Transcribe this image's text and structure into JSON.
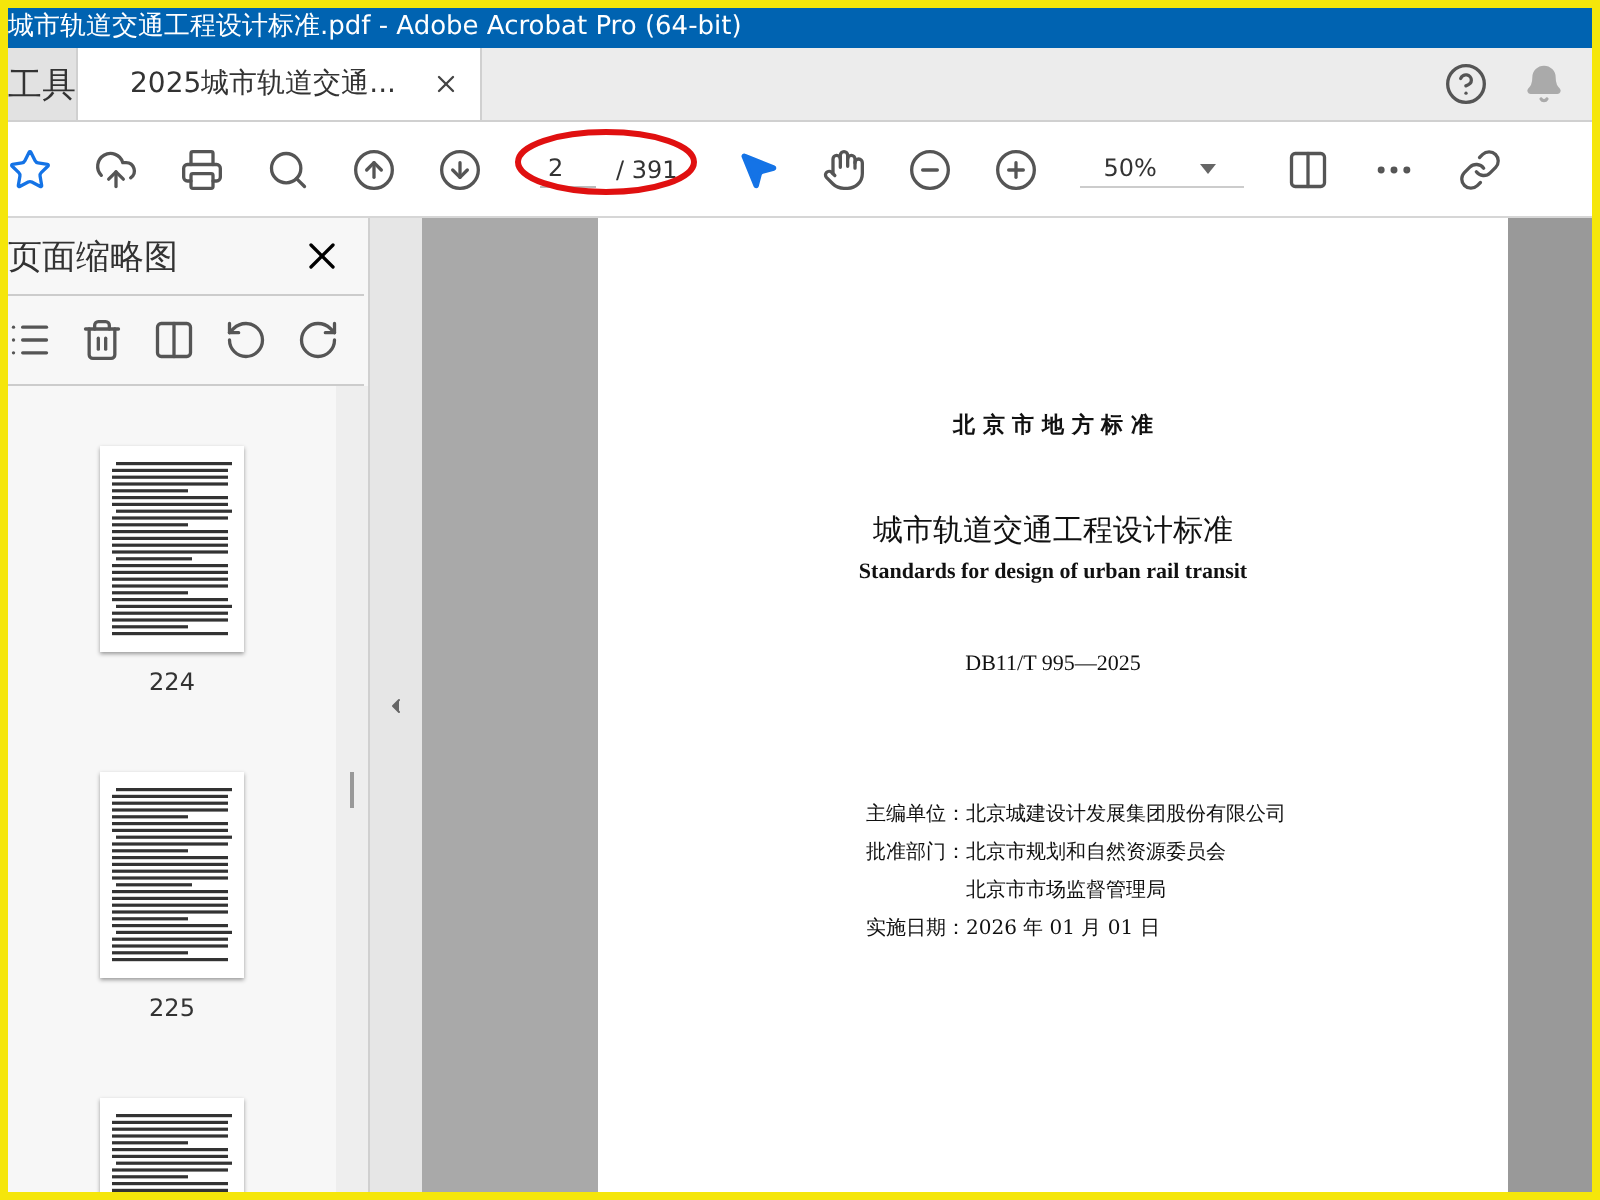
{
  "window": {
    "title": "城市轨道交通工程设计标准.pdf - Adobe Acrobat Pro (64-bit)"
  },
  "tabs": [
    {
      "label": "工具",
      "selected": false,
      "closable": false
    },
    {
      "label": "2025城市轨道交通...",
      "selected": true,
      "closable": true
    }
  ],
  "toolbar": {
    "page_value": "2",
    "page_total": "/ 391",
    "zoom": "50%"
  },
  "thumbnail_panel": {
    "title": "页面缩略图",
    "thumbnails": [
      {
        "label": "224",
        "partial": false
      },
      {
        "label": "225",
        "partial": false
      },
      {
        "partial": true
      }
    ]
  },
  "document": {
    "header": "北 京 市 地 方 标 准",
    "title": "城市轨道交通工程设计标准",
    "subtitle": "Standards for design of urban rail transit",
    "code": "DB11/T 995—2025",
    "details": [
      {
        "label": "主编单位：",
        "value": "北京城建设计发展集团股份有限公司"
      },
      {
        "label": "批准部门：",
        "value": "北京市规划和自然资源委员会"
      },
      {
        "value": "北京市市场监督管理局"
      },
      {
        "label": "实施日期：",
        "value": "2026 年 01 月 01 日"
      }
    ]
  }
}
